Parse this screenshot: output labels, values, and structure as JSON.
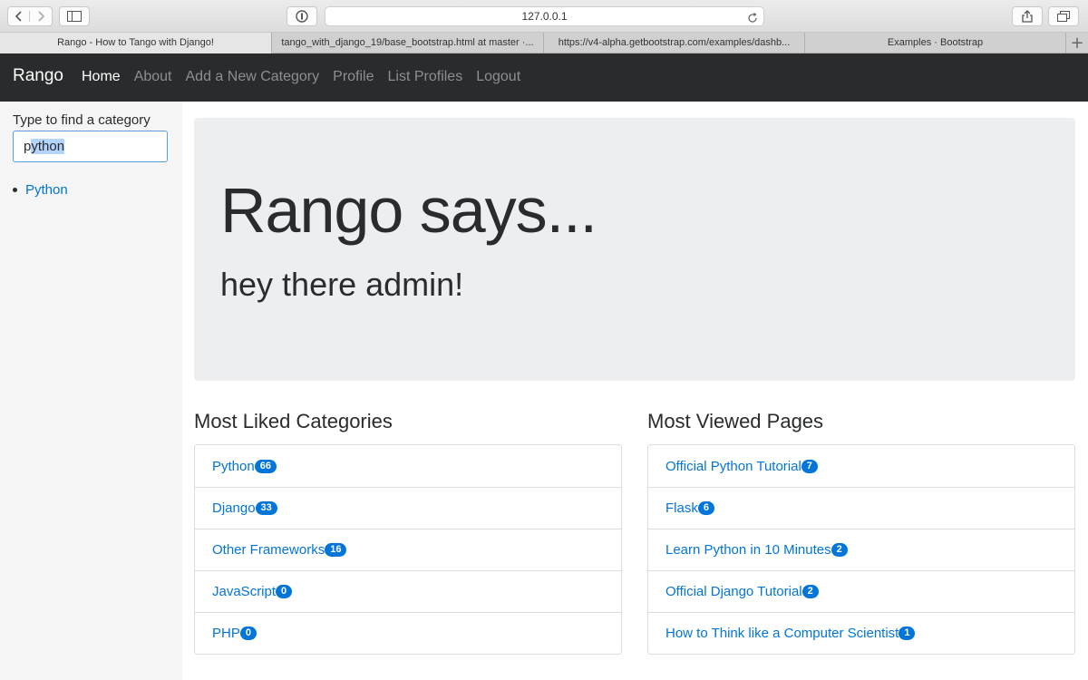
{
  "browser": {
    "url": "127.0.0.1",
    "tabs": [
      {
        "title": "Rango - How to Tango with Django!"
      },
      {
        "title": "tango_with_django_19/base_bootstrap.html at master ·..."
      },
      {
        "title": "https://v4-alpha.getbootstrap.com/examples/dashb..."
      },
      {
        "title": "Examples · Bootstrap"
      }
    ]
  },
  "navbar": {
    "brand": "Rango",
    "links": [
      {
        "label": "Home"
      },
      {
        "label": "About"
      },
      {
        "label": "Add a New Category"
      },
      {
        "label": "Profile"
      },
      {
        "label": "List Profiles"
      },
      {
        "label": "Logout"
      }
    ]
  },
  "sidebar": {
    "label": "Type to find a category",
    "input_prefix": "p",
    "input_selected": "ython",
    "results": [
      {
        "label": "Python"
      }
    ]
  },
  "jumbotron": {
    "heading": "Rango says...",
    "subheading": "hey there admin!"
  },
  "liked": {
    "title": "Most Liked Categories",
    "items": [
      {
        "label": "Python",
        "count": "66"
      },
      {
        "label": "Django",
        "count": "33"
      },
      {
        "label": "Other Frameworks",
        "count": "16"
      },
      {
        "label": "JavaScript",
        "count": "0"
      },
      {
        "label": "PHP",
        "count": "0"
      }
    ]
  },
  "viewed": {
    "title": "Most Viewed Pages",
    "items": [
      {
        "label": "Official Python Tutorial",
        "count": "7"
      },
      {
        "label": "Flask",
        "count": "6"
      },
      {
        "label": "Learn Python in 10 Minutes",
        "count": "2"
      },
      {
        "label": "Official Django Tutorial",
        "count": "2"
      },
      {
        "label": "How to Think like a Computer Scientist",
        "count": "1"
      }
    ]
  }
}
